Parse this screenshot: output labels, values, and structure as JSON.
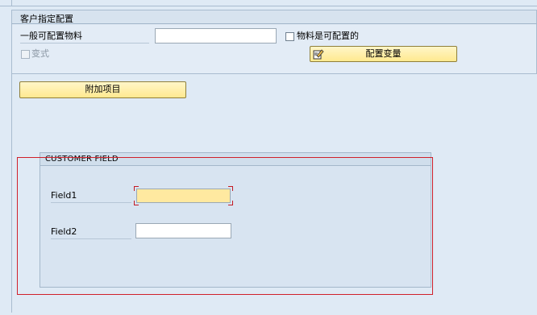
{
  "customer_config": {
    "section_title": "客户指定配置",
    "general_material_label": "一般可配置物料",
    "general_material_value": "",
    "material_configurable_label": "物料是可配置的",
    "variant_label": "变式",
    "config_variant_button": "配置变量",
    "additional_items_button": "附加项目"
  },
  "customer_field": {
    "title": "CUSTOMER FIELD",
    "field1_label": "Field1",
    "field1_value": "",
    "field2_label": "Field2",
    "field2_value": ""
  },
  "colors": {
    "background": "#dfeaf5",
    "button_yellow": "#ffe98f",
    "highlight_red": "#d0202a",
    "focused_input": "#ffe9a0"
  }
}
